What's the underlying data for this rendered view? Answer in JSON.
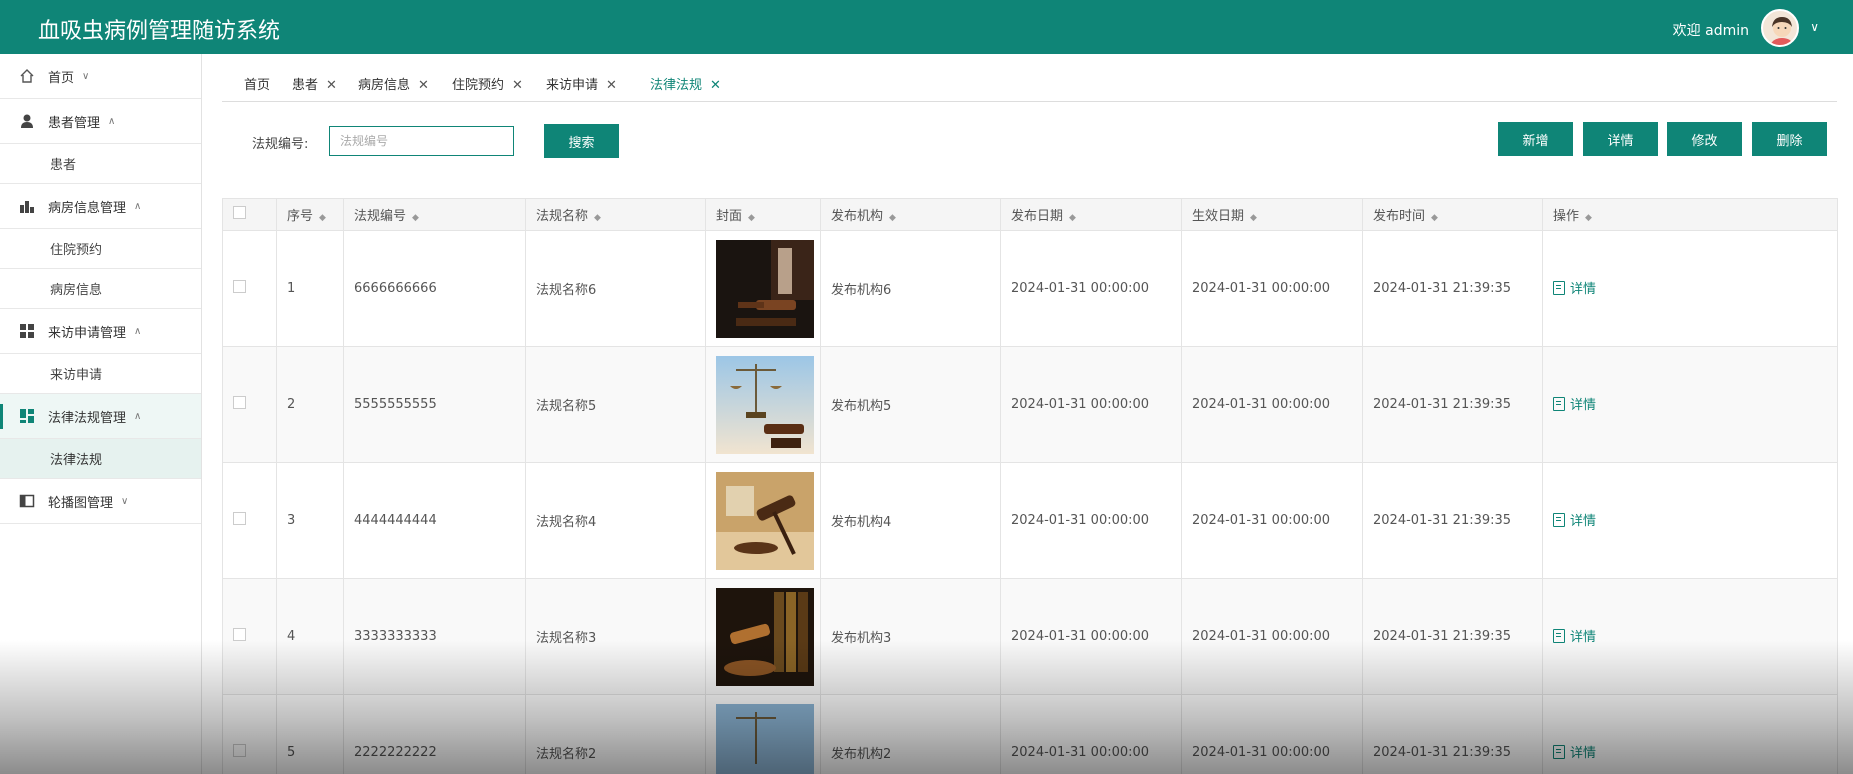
{
  "header": {
    "title": "血吸虫病例管理随访系统",
    "welcome": "欢迎 admin"
  },
  "sidebar": {
    "menus": [
      {
        "label": "首页",
        "icon": "home-icon",
        "arrow": "∨"
      },
      {
        "label": "患者管理",
        "icon": "user-icon",
        "arrow": "∧",
        "children": [
          "患者"
        ]
      },
      {
        "label": "病房信息管理",
        "icon": "chart-icon",
        "arrow": "∧",
        "children": [
          "住院预约",
          "病房信息"
        ]
      },
      {
        "label": "来访申请管理",
        "icon": "grid-icon",
        "arrow": "∧",
        "children": [
          "来访申请"
        ]
      },
      {
        "label": "法律法规管理",
        "icon": "dashboard-icon",
        "arrow": "∧",
        "children": [
          "法律法规"
        ]
      },
      {
        "label": "轮播图管理",
        "icon": "panel-icon",
        "arrow": "∨"
      }
    ]
  },
  "tabs": [
    {
      "label": "首页"
    },
    {
      "label": "患者"
    },
    {
      "label": "病房信息"
    },
    {
      "label": "住院预约"
    },
    {
      "label": "来访申请"
    },
    {
      "label": "法律法规"
    }
  ],
  "search": {
    "label": "法规编号:",
    "placeholder": "法规编号",
    "button": "搜索"
  },
  "actions": {
    "add": "新增",
    "detail": "详情",
    "edit": "修改",
    "delete": "删除"
  },
  "table": {
    "columns": [
      "序号",
      "法规编号",
      "法规名称",
      "封面",
      "发布机构",
      "发布日期",
      "生效日期",
      "发布时间",
      "操作"
    ],
    "op_label": "详情",
    "rows": [
      {
        "index": "1",
        "code": "6666666666",
        "name": "法规名称6",
        "org": "发布机构6",
        "pub_date": "2024-01-31 00:00:00",
        "eff_date": "2024-01-31 00:00:00",
        "pub_time": "2024-01-31 21:39:35"
      },
      {
        "index": "2",
        "code": "5555555555",
        "name": "法规名称5",
        "org": "发布机构5",
        "pub_date": "2024-01-31 00:00:00",
        "eff_date": "2024-01-31 00:00:00",
        "pub_time": "2024-01-31 21:39:35"
      },
      {
        "index": "3",
        "code": "4444444444",
        "name": "法规名称4",
        "org": "发布机构4",
        "pub_date": "2024-01-31 00:00:00",
        "eff_date": "2024-01-31 00:00:00",
        "pub_time": "2024-01-31 21:39:35"
      },
      {
        "index": "4",
        "code": "3333333333",
        "name": "法规名称3",
        "org": "发布机构3",
        "pub_date": "2024-01-31 00:00:00",
        "eff_date": "2024-01-31 00:00:00",
        "pub_time": "2024-01-31 21:39:35"
      },
      {
        "index": "5",
        "code": "2222222222",
        "name": "法规名称2",
        "org": "发布机构2",
        "pub_date": "2024-01-31 00:00:00",
        "eff_date": "2024-01-31 00:00:00",
        "pub_time": "2024-01-31 21:39:35"
      }
    ]
  },
  "colors": {
    "primary": "#0f8577"
  }
}
